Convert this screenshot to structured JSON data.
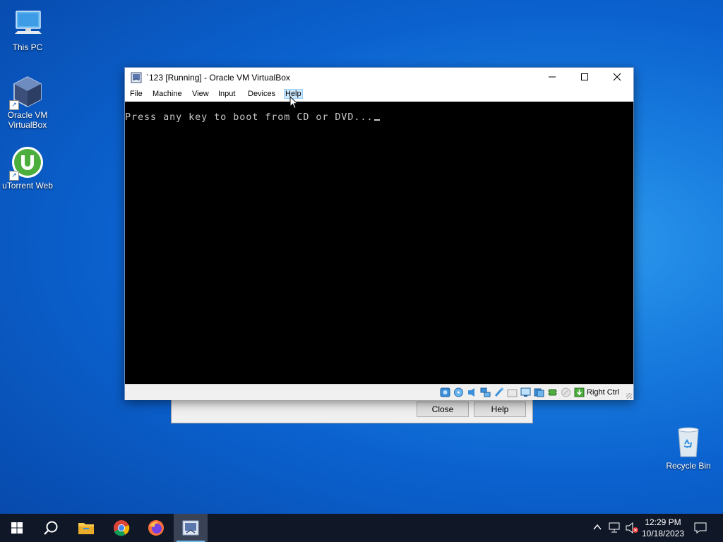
{
  "desktop": {
    "icons": [
      {
        "label": "This PC",
        "icon": "computer-icon"
      },
      {
        "label": "Oracle VM VirtualBox",
        "label_line1": "Oracle VM",
        "label_line2": "VirtualBox",
        "icon": "virtualbox-icon"
      },
      {
        "label": "uTorrent Web",
        "icon": "utorrent-icon"
      },
      {
        "label": "Recycle Bin",
        "icon": "recycle-bin-icon"
      }
    ]
  },
  "background_dialog": {
    "close_label": "Close",
    "help_label": "Help"
  },
  "vbox": {
    "title": "`123 [Running] - Oracle VM VirtualBox",
    "menu": [
      "File",
      "Machine",
      "View",
      "Input",
      "Devices",
      "Help"
    ],
    "hovered_menu": "Help",
    "screen_text": "Press any key to boot from CD or DVD...",
    "status_icons": [
      "hard-disk-icon",
      "optical-drive-icon",
      "audio-icon",
      "network-icon",
      "usb-icon",
      "shared-folders-icon",
      "display-icon",
      "video-capture-icon",
      "cpu-icon",
      "mouse-integration-icon",
      "keyboard-icon"
    ],
    "host_key": "Right Ctrl"
  },
  "taskbar": {
    "apps": [
      "start-icon",
      "search-icon",
      "file-explorer-icon",
      "chrome-icon",
      "firefox-icon",
      "virtualbox-icon"
    ],
    "active_app": "virtualbox-icon",
    "time": "12:29 PM",
    "date": "10/18/2023"
  },
  "colors": {
    "desktop_blue": "#1a7fe0",
    "taskbar": "#101828",
    "vm_screen": "#000000",
    "boot_text": "#c8c8c8"
  }
}
